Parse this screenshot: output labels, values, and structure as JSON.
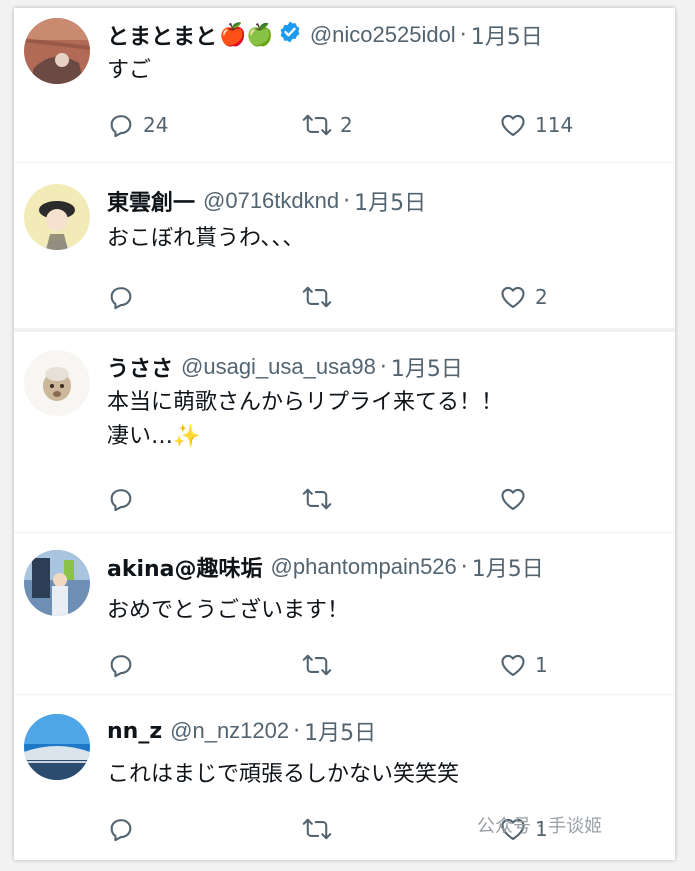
{
  "tweets": [
    {
      "name": "とまとまと",
      "emojis": "🍎🍏",
      "verified": true,
      "handle": "@nico2525idol",
      "date": "1月5日",
      "text_lines": [
        "すご"
      ],
      "replies": "24",
      "retweets": "2",
      "likes": "114"
    },
    {
      "name": "東雲創一",
      "handle": "@0716tkdknd",
      "date": "1月5日",
      "text_lines": [
        "おこぼれ貰うわ､､､"
      ],
      "replies": "",
      "retweets": "",
      "likes": "2"
    },
    {
      "name": "うささ",
      "handle": "@usagi_usa_usa98",
      "date": "1月5日",
      "text_lines": [
        "本当に萌歌さんからリプライ来てる！！",
        "凄い…✨"
      ],
      "replies": "",
      "retweets": "",
      "likes": ""
    },
    {
      "name": "akina@趣味垢",
      "handle": "@phantompain526",
      "date": "1月5日",
      "text_lines": [
        "おめでとうございます！"
      ],
      "replies": "",
      "retweets": "",
      "likes": "1"
    },
    {
      "name": "nn_z",
      "handle": "@n_nz1202",
      "date": "1月5日",
      "text_lines": [
        "これはまじで頑張るしかない笑笑笑"
      ],
      "replies": "",
      "retweets": "",
      "likes": "1"
    }
  ],
  "separator": "·",
  "watermark": "公众号 · 手谈姬",
  "colors": {
    "verified": "#1d9bf0",
    "secondary": "#536471"
  },
  "icons": {
    "reply": "reply-icon",
    "retweet": "retweet-icon",
    "like": "heart-icon"
  }
}
